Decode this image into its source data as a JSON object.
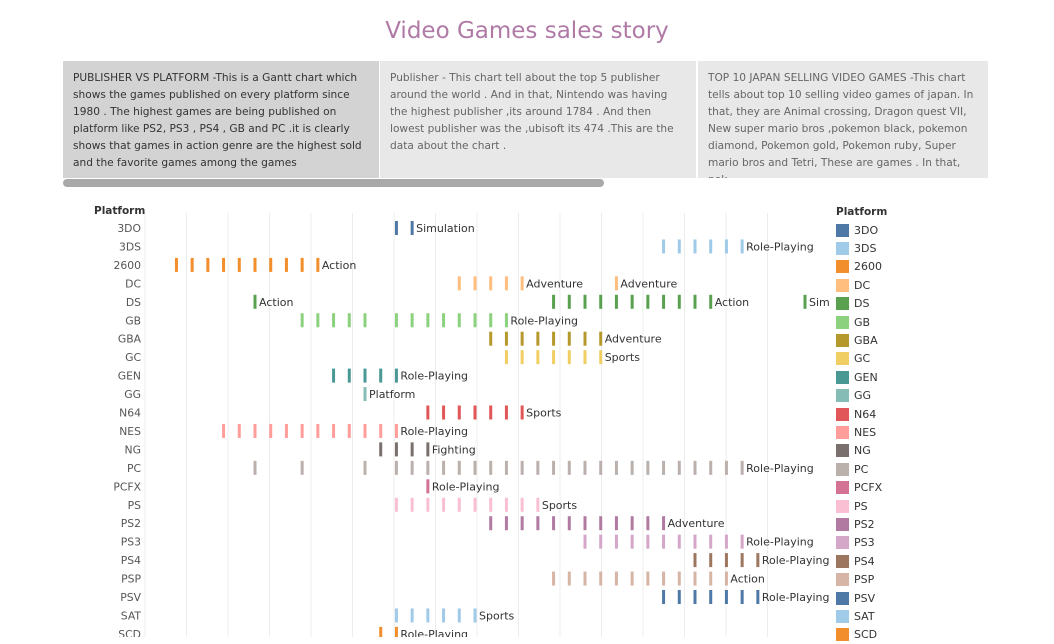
{
  "story": {
    "title": "Video Games sales story",
    "points": [
      "PUBLISHER VS PLATFORM -This is a Gantt chart which shows the games published on every platform since 1980 . The highest games are being published on platform like PS2, PS3 , PS4 , GB and PC .it is clearly shows that games in action genre are the highest sold and the favorite games among the games",
      "Publisher - This chart tell about the top 5 publisher around the world . And in that, Nintendo was having the highest publisher ,its around 1784 . And then lowest publisher was the ,ubisoft its 474 .This are the data about the chart .",
      "TOP 10 JAPAN SELLING VIDEO GAMES -This chart tells about top 10 selling video games of japan. In that, they are Animal crossing, Dragon quest VII, New super mario bros ,pokemon black, pokemon diamond, Pokemon gold, Pokemon ruby, Super mario bros and Tetri, These are games . In that, pok.."
    ]
  },
  "chart_data": {
    "type": "gantt",
    "row_header": "Platform",
    "x_axis": "year",
    "xlim": [
      1978,
      2020
    ],
    "rows": [
      {
        "platform": "3DO",
        "color": "#4e79a7",
        "years": [
          1994,
          1995
        ],
        "labels": [
          {
            "year": 1995,
            "text": "Simulation"
          }
        ]
      },
      {
        "platform": "3DS",
        "color": "#a0cbe8",
        "years": [
          2011,
          2012,
          2013,
          2014,
          2015,
          2016
        ],
        "labels": [
          {
            "year": 2016,
            "text": "Role-Playing"
          }
        ]
      },
      {
        "platform": "2600",
        "color": "#f28e2b",
        "years": [
          1980,
          1981,
          1982,
          1983,
          1984,
          1985,
          1986,
          1987,
          1988,
          1989
        ],
        "labels": [
          {
            "year": 1989,
            "text": "Action"
          }
        ]
      },
      {
        "platform": "DC",
        "color": "#ffbe7d",
        "years": [
          1998,
          1999,
          2000,
          2001,
          2002,
          2008
        ],
        "labels": [
          {
            "year": 2002,
            "text": "Adventure"
          },
          {
            "year": 2008,
            "text": "Adventure"
          }
        ]
      },
      {
        "platform": "DS",
        "color": "#59a14f",
        "years": [
          1985,
          2004,
          2005,
          2006,
          2007,
          2008,
          2009,
          2010,
          2011,
          2012,
          2013,
          2014,
          2020
        ],
        "labels": [
          {
            "year": 1985,
            "text": "Action"
          },
          {
            "year": 2014,
            "text": "Action"
          },
          {
            "year": 2020,
            "text": "Simulation"
          }
        ]
      },
      {
        "platform": "GB",
        "color": "#8cd17d",
        "years": [
          1988,
          1989,
          1990,
          1991,
          1992,
          1994,
          1995,
          1996,
          1997,
          1998,
          1999,
          2000,
          2001
        ],
        "labels": [
          {
            "year": 2001,
            "text": "Role-Playing"
          }
        ]
      },
      {
        "platform": "GBA",
        "color": "#b6992d",
        "years": [
          2000,
          2001,
          2002,
          2003,
          2004,
          2005,
          2006,
          2007
        ],
        "labels": [
          {
            "year": 2007,
            "text": "Adventure"
          }
        ]
      },
      {
        "platform": "GC",
        "color": "#f1ce63",
        "years": [
          2001,
          2002,
          2003,
          2004,
          2005,
          2006,
          2007
        ],
        "labels": [
          {
            "year": 2007,
            "text": "Sports"
          }
        ]
      },
      {
        "platform": "GEN",
        "color": "#499894",
        "years": [
          1990,
          1991,
          1992,
          1993,
          1994
        ],
        "labels": [
          {
            "year": 1994,
            "text": "Role-Playing"
          }
        ]
      },
      {
        "platform": "GG",
        "color": "#86bcb6",
        "years": [
          1992
        ],
        "labels": [
          {
            "year": 1992,
            "text": "Platform"
          }
        ]
      },
      {
        "platform": "N64",
        "color": "#e15759",
        "years": [
          1996,
          1997,
          1998,
          1999,
          2000,
          2001,
          2002
        ],
        "labels": [
          {
            "year": 2002,
            "text": "Sports"
          }
        ]
      },
      {
        "platform": "NES",
        "color": "#ff9d9a",
        "years": [
          1983,
          1984,
          1985,
          1986,
          1987,
          1988,
          1989,
          1990,
          1991,
          1992,
          1993,
          1994
        ],
        "labels": [
          {
            "year": 1994,
            "text": "Role-Playing"
          }
        ]
      },
      {
        "platform": "NG",
        "color": "#79706e",
        "years": [
          1993,
          1994,
          1995,
          1996
        ],
        "labels": [
          {
            "year": 1996,
            "text": "Fighting"
          }
        ]
      },
      {
        "platform": "PC",
        "color": "#bab0ac",
        "years": [
          1985,
          1988,
          1992,
          1994,
          1995,
          1996,
          1997,
          1998,
          1999,
          2000,
          2001,
          2002,
          2003,
          2004,
          2005,
          2006,
          2007,
          2008,
          2009,
          2010,
          2011,
          2012,
          2013,
          2014,
          2015,
          2016
        ],
        "labels": [
          {
            "year": 2016,
            "text": "Role-Playing"
          }
        ]
      },
      {
        "platform": "PCFX",
        "color": "#d37295",
        "years": [
          1996
        ],
        "labels": [
          {
            "year": 1996,
            "text": "Role-Playing"
          }
        ]
      },
      {
        "platform": "PS",
        "color": "#fabfd2",
        "years": [
          1994,
          1995,
          1996,
          1997,
          1998,
          1999,
          2000,
          2001,
          2002,
          2003
        ],
        "labels": [
          {
            "year": 2003,
            "text": "Sports"
          }
        ]
      },
      {
        "platform": "PS2",
        "color": "#b07aa1",
        "years": [
          2000,
          2001,
          2002,
          2003,
          2004,
          2005,
          2006,
          2007,
          2008,
          2009,
          2010,
          2011
        ],
        "labels": [
          {
            "year": 2011,
            "text": "Adventure"
          }
        ]
      },
      {
        "platform": "PS3",
        "color": "#d4a6c8",
        "years": [
          2006,
          2007,
          2008,
          2009,
          2010,
          2011,
          2012,
          2013,
          2014,
          2015,
          2016
        ],
        "labels": [
          {
            "year": 2016,
            "text": "Role-Playing"
          }
        ]
      },
      {
        "platform": "PS4",
        "color": "#9d7660",
        "years": [
          2013,
          2014,
          2015,
          2016,
          2017
        ],
        "labels": [
          {
            "year": 2017,
            "text": "Role-Playing"
          }
        ]
      },
      {
        "platform": "PSP",
        "color": "#d7b5a6",
        "years": [
          2004,
          2005,
          2006,
          2007,
          2008,
          2009,
          2010,
          2011,
          2012,
          2013,
          2014,
          2015
        ],
        "labels": [
          {
            "year": 2015,
            "text": "Action"
          }
        ]
      },
      {
        "platform": "PSV",
        "color": "#4e79a7",
        "years": [
          2011,
          2012,
          2013,
          2014,
          2015,
          2016,
          2017
        ],
        "labels": [
          {
            "year": 2017,
            "text": "Role-Playing"
          }
        ]
      },
      {
        "platform": "SAT",
        "color": "#a0cbe8",
        "years": [
          1994,
          1995,
          1996,
          1997,
          1998,
          1999
        ],
        "labels": [
          {
            "year": 1999,
            "text": "Sports"
          }
        ]
      },
      {
        "platform": "SCD",
        "color": "#f28e2b",
        "years": [
          1993,
          1994
        ],
        "labels": [
          {
            "year": 1994,
            "text": "Role-Playing"
          }
        ]
      }
    ]
  }
}
